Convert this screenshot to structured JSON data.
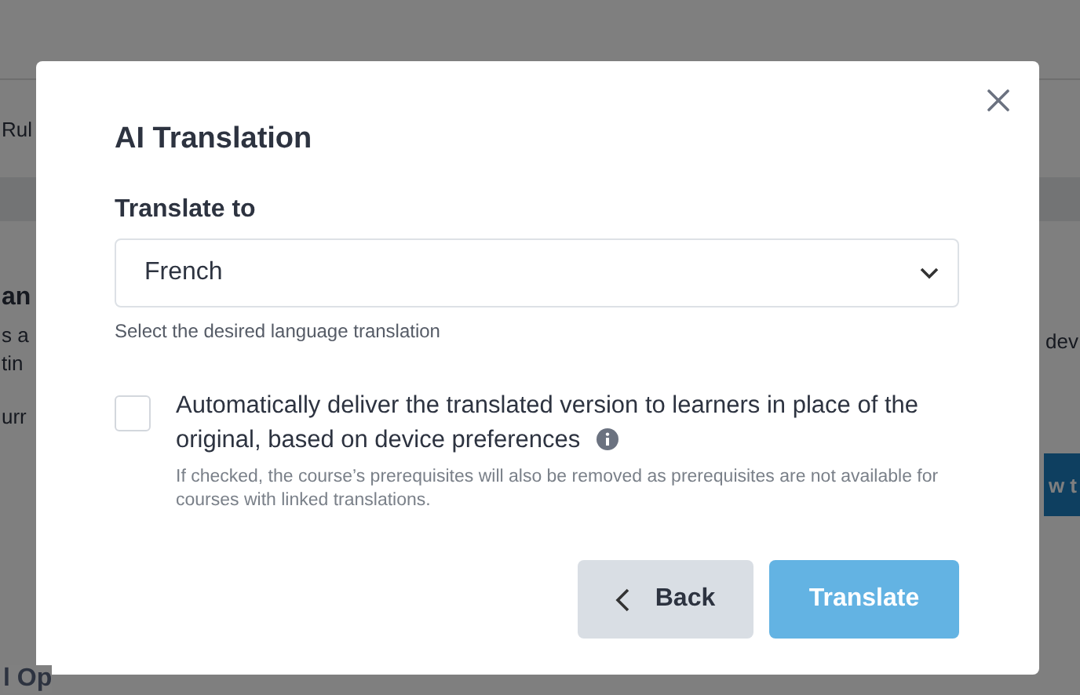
{
  "background": {
    "tab_fragment": "Rul",
    "heading_fragment": "an",
    "text_fragments": [
      "s a",
      "tin",
      "urr"
    ],
    "right_text_fragment": "dev",
    "right_button_fragment": "w t",
    "bottom_heading_fragment": "l Op"
  },
  "dialog": {
    "title": "AI Translation",
    "field_label": "Translate to",
    "select": {
      "value": "French"
    },
    "help": "Select the desired language translation",
    "option": {
      "checked": false,
      "label": "Automatically deliver the translated version to learners in place of the original, based on device preferences",
      "note": "If checked, the course’s prerequisites will also be removed as prerequisites are not available for courses with linked translations."
    },
    "buttons": [
      {
        "kind": "back",
        "label": "Back"
      },
      {
        "kind": "primary",
        "label": "Translate"
      }
    ]
  }
}
